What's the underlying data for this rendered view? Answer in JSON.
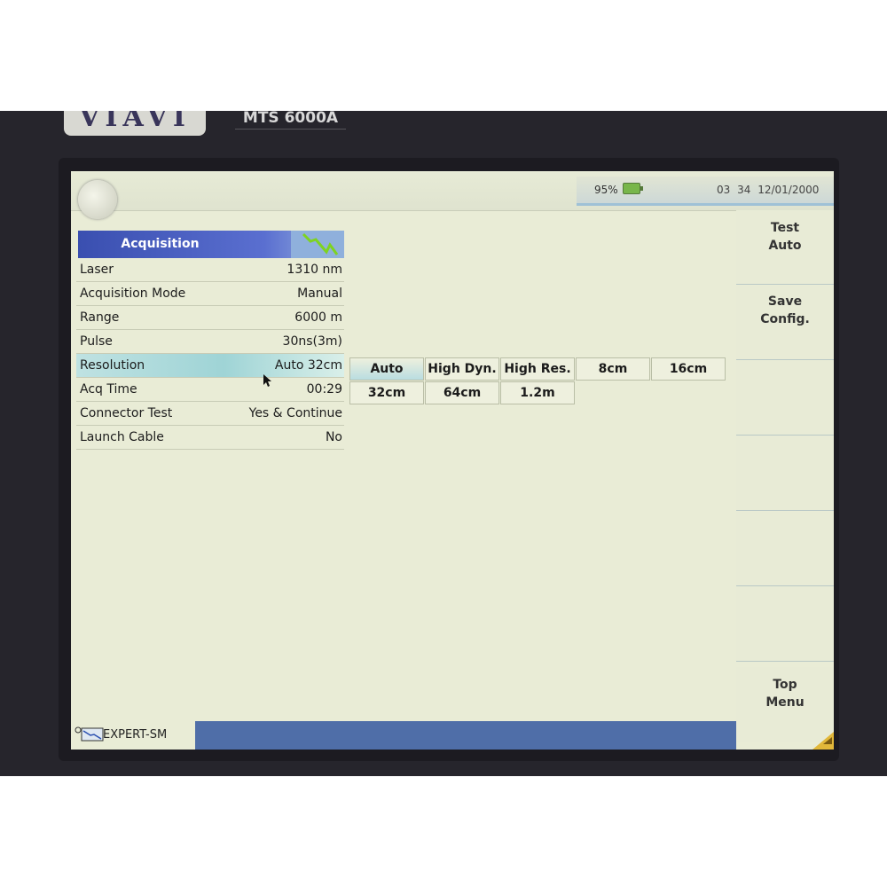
{
  "device": {
    "brand": "VIAVI",
    "model": "MTS 6000A"
  },
  "topbar": {
    "battery_percent": "95%",
    "time": "03 34",
    "date": "12/01/2000"
  },
  "acquisition": {
    "title": "Acquisition",
    "params": [
      {
        "label": "Laser",
        "value": "1310 nm"
      },
      {
        "label": "Acquisition Mode",
        "value": "Manual"
      },
      {
        "label": "Range",
        "value": "6000 m"
      },
      {
        "label": "Pulse",
        "value": "30ns(3m)"
      },
      {
        "label": "Resolution",
        "value": "Auto 32cm",
        "selected": true
      },
      {
        "label": "Acq Time",
        "value": "00:29"
      },
      {
        "label": "Connector Test",
        "value": "Yes & Continue"
      },
      {
        "label": "Launch Cable",
        "value": "No"
      }
    ]
  },
  "resolution_options": {
    "row1": [
      "Auto",
      "High Dyn.",
      "High Res.",
      "8cm",
      "16cm"
    ],
    "row2": [
      "32cm",
      "64cm",
      "1.2m"
    ],
    "active": "Auto"
  },
  "softkeys": [
    {
      "line1": "Test",
      "line2": "Auto"
    },
    {
      "line1": "Save",
      "line2": "Config."
    },
    {
      "line1": "",
      "line2": ""
    },
    {
      "line1": "",
      "line2": ""
    },
    {
      "line1": "",
      "line2": ""
    },
    {
      "line1": "",
      "line2": ""
    },
    {
      "line1": "Top",
      "line2": "Menu"
    }
  ],
  "statusbar": {
    "module": "EXPERT-SM"
  },
  "colors": {
    "screen_bg": "#e9ecd6",
    "header_blue": "#3a4fb0",
    "selection": "#9fd4d6",
    "status_blue": "#4f6ea8",
    "battery_green": "#78b64a"
  }
}
